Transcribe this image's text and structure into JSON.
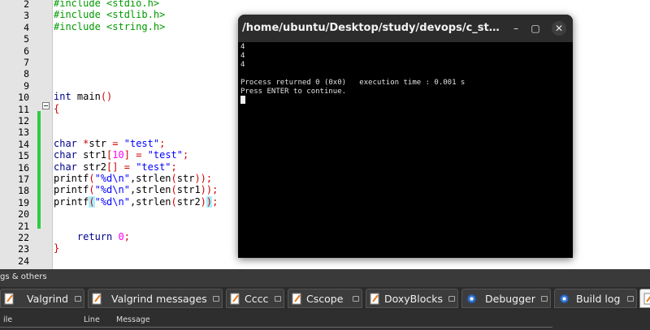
{
  "editor": {
    "line_numbers": [
      "2",
      "3",
      "4",
      "5",
      "6",
      "7",
      "8",
      "9",
      "10",
      "11",
      "12",
      "13",
      "14",
      "15",
      "16",
      "17",
      "18",
      "19",
      "20",
      "21",
      "22",
      "23",
      "24"
    ],
    "lines": {
      "l2": [
        {
          "t": "#include <stdio.h>",
          "c": "pp"
        }
      ],
      "l3": [
        {
          "t": "#include <stdlib.h>",
          "c": "pp"
        }
      ],
      "l4": [
        {
          "t": "#include <string.h>",
          "c": "pp"
        }
      ],
      "l10": [
        {
          "t": "int",
          "c": "kw"
        },
        {
          "t": " main",
          "c": ""
        },
        {
          "t": "()",
          "c": "op"
        }
      ],
      "l11": [
        {
          "t": "{",
          "c": "op"
        }
      ],
      "l14": [
        {
          "t": "char",
          "c": "kw"
        },
        {
          "t": " ",
          "c": ""
        },
        {
          "t": "*",
          "c": "op"
        },
        {
          "t": "str ",
          "c": ""
        },
        {
          "t": "=",
          "c": "op"
        },
        {
          "t": " ",
          "c": ""
        },
        {
          "t": "\"test\"",
          "c": "str"
        },
        {
          "t": ";",
          "c": "op"
        }
      ],
      "l15": [
        {
          "t": "char",
          "c": "kw"
        },
        {
          "t": " str1",
          "c": ""
        },
        {
          "t": "[",
          "c": "op"
        },
        {
          "t": "10",
          "c": "num"
        },
        {
          "t": "]",
          "c": "op"
        },
        {
          "t": " ",
          "c": ""
        },
        {
          "t": "=",
          "c": "op"
        },
        {
          "t": " ",
          "c": ""
        },
        {
          "t": "\"test\"",
          "c": "str"
        },
        {
          "t": ";",
          "c": "op"
        }
      ],
      "l16": [
        {
          "t": "char",
          "c": "kw"
        },
        {
          "t": " str2",
          "c": ""
        },
        {
          "t": "[]",
          "c": "op"
        },
        {
          "t": " ",
          "c": ""
        },
        {
          "t": "=",
          "c": "op"
        },
        {
          "t": " ",
          "c": ""
        },
        {
          "t": "\"test\"",
          "c": "str"
        },
        {
          "t": ";",
          "c": "op"
        }
      ],
      "l17": [
        {
          "t": "printf",
          "c": ""
        },
        {
          "t": "(",
          "c": "op"
        },
        {
          "t": "\"%d\\n\"",
          "c": "str"
        },
        {
          "t": ",strlen",
          "c": ""
        },
        {
          "t": "(",
          "c": "op"
        },
        {
          "t": "str",
          "c": ""
        },
        {
          "t": "));",
          "c": "op"
        }
      ],
      "l18": [
        {
          "t": "printf",
          "c": ""
        },
        {
          "t": "(",
          "c": "op"
        },
        {
          "t": "\"%d\\n\"",
          "c": "str"
        },
        {
          "t": ",strlen",
          "c": ""
        },
        {
          "t": "(",
          "c": "op"
        },
        {
          "t": "str1",
          "c": ""
        },
        {
          "t": "));",
          "c": "op"
        }
      ],
      "l19": [
        {
          "t": "printf",
          "c": ""
        },
        {
          "t": "(",
          "c": "op hl"
        },
        {
          "t": "\"%d\\n\"",
          "c": "str"
        },
        {
          "t": ",strlen",
          "c": ""
        },
        {
          "t": "(",
          "c": "op"
        },
        {
          "t": "str2",
          "c": ""
        },
        {
          "t": ")",
          "c": "op"
        },
        {
          "t": ")",
          "c": "op hl"
        },
        {
          "t": ";",
          "c": "op"
        }
      ],
      "l22": [
        {
          "t": "    ",
          "c": ""
        },
        {
          "t": "return",
          "c": "kw"
        },
        {
          "t": " ",
          "c": ""
        },
        {
          "t": "0",
          "c": "num"
        },
        {
          "t": ";",
          "c": "op"
        }
      ],
      "l23": [
        {
          "t": "}",
          "c": "op"
        }
      ]
    }
  },
  "terminal": {
    "title": "/home/ubuntu/Desktop/study/devops/c_study/Giraffe",
    "minimize_glyph": "–",
    "maximize_glyph": "▢",
    "close_glyph": "✕",
    "output": [
      "4",
      "4",
      "4",
      "",
      "Process returned 0 (0x0)   execution time : 0.001 s",
      "Press ENTER to continue."
    ]
  },
  "panel": {
    "title": "gs & others",
    "tabs": [
      "Valgrind",
      "Valgrind messages",
      "Cccc",
      "Cscope",
      "DoxyBlocks",
      "Debugger",
      "Build log"
    ],
    "columns": [
      "ile",
      "Line",
      "Message"
    ]
  },
  "colors": {
    "preprocessor": "#009900",
    "keyword": "#00008b",
    "string": "#0000ff",
    "operator": "#d00000",
    "number": "#ff00ff",
    "change_bar": "#2ecc40"
  }
}
